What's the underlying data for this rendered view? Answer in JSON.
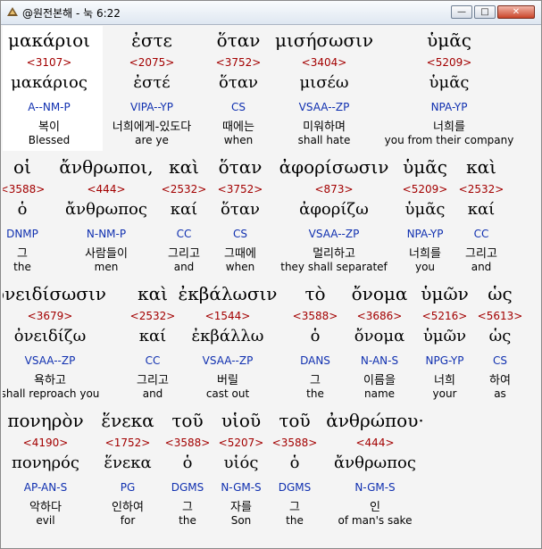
{
  "window": {
    "title": "@원전본해 - 눅 6:22",
    "min_label": "—",
    "max_label": "□",
    "close_label": "✕"
  },
  "colors": {
    "strong": "#a30000",
    "parse": "#1030b0",
    "highlight": "#ffffff",
    "background": "#f4f4f4"
  },
  "rows": [
    {
      "words": [
        {
          "greek": "μακάριοι",
          "strong": "<3107>",
          "lemma": "μακάριος",
          "parse": "A--NM-P",
          "korean": "복이",
          "english": "Blessed"
        },
        {
          "greek": "ἐστε",
          "strong": "<2075>",
          "lemma": "ἐστέ",
          "parse": "VIPA--YP",
          "korean": "너희에게-있도다",
          "english": "are ye"
        },
        {
          "greek": "ὅταν",
          "strong": "<3752>",
          "lemma": "ὅταν",
          "parse": "CS",
          "korean": "때에는",
          "english": "when"
        },
        {
          "greek": "μισήσωσιν",
          "strong": "<3404>",
          "lemma": "μισέω",
          "parse": "VSAA--ZP",
          "korean": "미워하며",
          "english": "shall hate"
        },
        {
          "greek": "ὑμᾶς",
          "strong": "<5209>",
          "lemma": "ὑμᾶς",
          "parse": "NPA-YP",
          "korean": "너희를",
          "english": "you from their company"
        }
      ]
    },
    {
      "words": [
        {
          "greek": "οἱ",
          "strong": "<3588>",
          "lemma": "ὁ",
          "parse": "DNMP",
          "korean": "그",
          "english": "the"
        },
        {
          "greek": "ἄνθρωποι,",
          "strong": "<444>",
          "lemma": "ἄνθρωπος",
          "parse": "N-NM-P",
          "korean": "사람들이",
          "english": "men"
        },
        {
          "greek": "καὶ",
          "strong": "<2532>",
          "lemma": "καί",
          "parse": "CC",
          "korean": "그리고",
          "english": "and"
        },
        {
          "greek": "ὅταν",
          "strong": "<3752>",
          "lemma": "ὅταν",
          "parse": "CS",
          "korean": "그때에",
          "english": "when"
        },
        {
          "greek": "ἀφορίσωσιν",
          "strong": "<873>",
          "lemma": "ἀφορίζω",
          "parse": "VSAA--ZP",
          "korean": "멀리하고",
          "english": "they shall separatef"
        },
        {
          "greek": "ὑμᾶς",
          "strong": "<5209>",
          "lemma": "ὑμᾶς",
          "parse": "NPA-YP",
          "korean": "너희를",
          "english": "you"
        },
        {
          "greek": "καὶ",
          "strong": "<2532>",
          "lemma": "καί",
          "parse": "CC",
          "korean": "그리고",
          "english": "and"
        }
      ]
    },
    {
      "words": [
        {
          "greek": "ὀνειδίσωσιν",
          "strong": "<3679>",
          "lemma": "ὀνειδίζω",
          "parse": "VSAA--ZP",
          "korean": "욕하고",
          "english": "shall reproach you"
        },
        {
          "greek": "καὶ",
          "strong": "<2532>",
          "lemma": "καί",
          "parse": "CC",
          "korean": "그리고",
          "english": "and"
        },
        {
          "greek": "ἐκβάλωσιν",
          "strong": "<1544>",
          "lemma": "ἐκβάλλω",
          "parse": "VSAA--ZP",
          "korean": "버릴",
          "english": "cast out"
        },
        {
          "greek": "τὸ",
          "strong": "<3588>",
          "lemma": "ὁ",
          "parse": "DANS",
          "korean": "그",
          "english": "the"
        },
        {
          "greek": "ὄνομα",
          "strong": "<3686>",
          "lemma": "ὄνομα",
          "parse": "N-AN-S",
          "korean": "이름을",
          "english": "name"
        },
        {
          "greek": "ὑμῶν",
          "strong": "<5216>",
          "lemma": "ὑμῶν",
          "parse": "NPG-YP",
          "korean": "너희",
          "english": "your"
        },
        {
          "greek": "ὡς",
          "strong": "<5613>",
          "lemma": "ὡς",
          "parse": "CS",
          "korean": "하여",
          "english": "as"
        }
      ]
    },
    {
      "words": [
        {
          "greek": "πονηρὸν",
          "strong": "<4190>",
          "lemma": "πονηρός",
          "parse": "AP-AN-S",
          "korean": "악하다",
          "english": "evil"
        },
        {
          "greek": "ἕνεκα",
          "strong": "<1752>",
          "lemma": "ἕνεκα",
          "parse": "PG",
          "korean": "인하여",
          "english": "for"
        },
        {
          "greek": "τοῦ",
          "strong": "<3588>",
          "lemma": "ὁ",
          "parse": "DGMS",
          "korean": "그",
          "english": "the"
        },
        {
          "greek": "υἱοῦ",
          "strong": "<5207>",
          "lemma": "υἱός",
          "parse": "N-GM-S",
          "korean": "자를",
          "english": "Son"
        },
        {
          "greek": "τοῦ",
          "strong": "<3588>",
          "lemma": "ὁ",
          "parse": "DGMS",
          "korean": "그",
          "english": "the"
        },
        {
          "greek": "ἀνθρώπου·",
          "strong": "<444>",
          "lemma": "ἄνθρωπος",
          "parse": "N-GM-S",
          "korean": "인",
          "english": "of man's sake"
        }
      ]
    }
  ]
}
